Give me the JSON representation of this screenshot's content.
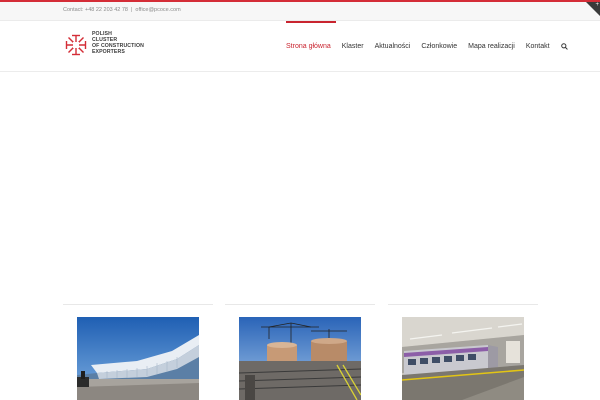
{
  "topbar": {
    "contact_label": "Contact: +48 22 203 42 78",
    "separator": "|",
    "email": "office@pcoce.com"
  },
  "logo": {
    "line1": "POLISH",
    "line2": "CLUSTER",
    "line3": "OF CONSTRUCTION",
    "line4": "EXPORTERS",
    "mark_color": "#d42d37"
  },
  "nav": {
    "items": [
      {
        "label": "Strona główna",
        "active": true
      },
      {
        "label": "Klaster",
        "active": false
      },
      {
        "label": "Aktualności",
        "active": false
      },
      {
        "label": "Członkowie",
        "active": false
      },
      {
        "label": "Mapa realizacji",
        "active": false
      },
      {
        "label": "Kontakt",
        "active": false
      }
    ],
    "search_icon": "search-icon"
  },
  "colors": {
    "accent": "#c9242f",
    "topbar_bg": "#f7f7f7"
  },
  "cards": [
    {
      "subject": "modern-building"
    },
    {
      "subject": "construction-site"
    },
    {
      "subject": "metro-train"
    }
  ]
}
